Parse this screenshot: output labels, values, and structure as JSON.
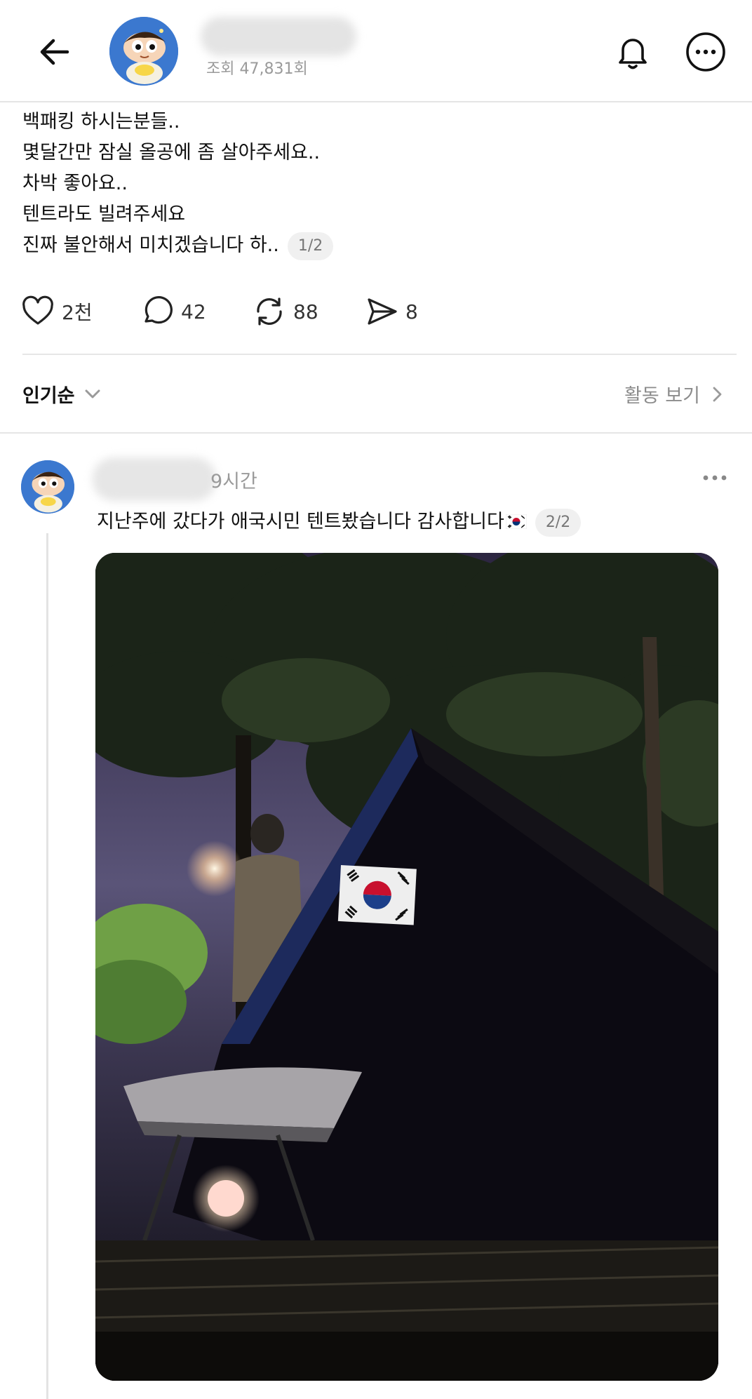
{
  "header": {
    "views": "조회 47,831회",
    "icons": {
      "back": "arrow-left-icon",
      "bell": "bell-icon",
      "more": "more-horizontal-icon"
    }
  },
  "post": {
    "lines": [
      "백패킹 하시는분들..",
      "몇달간만 잠실 올공에 좀 살아주세요..",
      "차박 좋아요..",
      "텐트라도 빌려주세요",
      "진짜 불안해서 미치겠습니다 하.."
    ],
    "pager": "1/2",
    "actions": {
      "likes": "2천",
      "comments": "42",
      "reposts": "88",
      "shares": "8"
    }
  },
  "sort": {
    "label": "인기순",
    "activity": "활동 보기"
  },
  "reply": {
    "time": "9시간",
    "text": "지난주에 갔다가 애국시민 텐트봤습니다 감사합니다",
    "pager": "2/2"
  },
  "colors": {
    "divider": "#e6e6e6",
    "muted": "#9a9a9a",
    "pager_bg": "#f0f0f0"
  }
}
